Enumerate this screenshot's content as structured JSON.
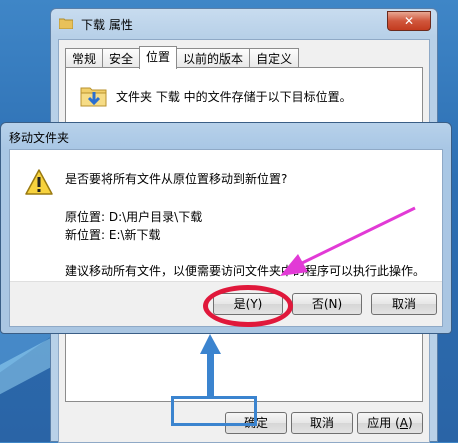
{
  "properties_window": {
    "title": "下载 属性",
    "close_symbol": "✕",
    "tabs": [
      {
        "label": "常规"
      },
      {
        "label": "安全"
      },
      {
        "label": "位置"
      },
      {
        "label": "以前的版本"
      },
      {
        "label": "自定义"
      }
    ],
    "active_tab": "位置",
    "location_description": "文件夹 下载 中的文件存储于以下目标位置。",
    "buttons": {
      "ok": "确定",
      "cancel": "取消",
      "apply_prefix": "应用 (",
      "apply_key": "A",
      "apply_suffix": ")"
    }
  },
  "move_dialog": {
    "title": "移动文件夹",
    "question": "是否要将所有文件从原位置移动到新位置?",
    "original_location": "原位置: D:\\用户目录\\下载",
    "new_location": "新位置: E:\\新下载",
    "advice": "建议移动所有文件，以便需要访问文件夹中的程序可以执行此操作。",
    "buttons": {
      "yes": "是(Y)",
      "no": "否(N)",
      "cancel": "取消"
    }
  },
  "colors": {
    "highlight_oval": "#e0183b",
    "arrow_magenta": "#e23ad6",
    "arrow_blue": "#3b84cf"
  }
}
